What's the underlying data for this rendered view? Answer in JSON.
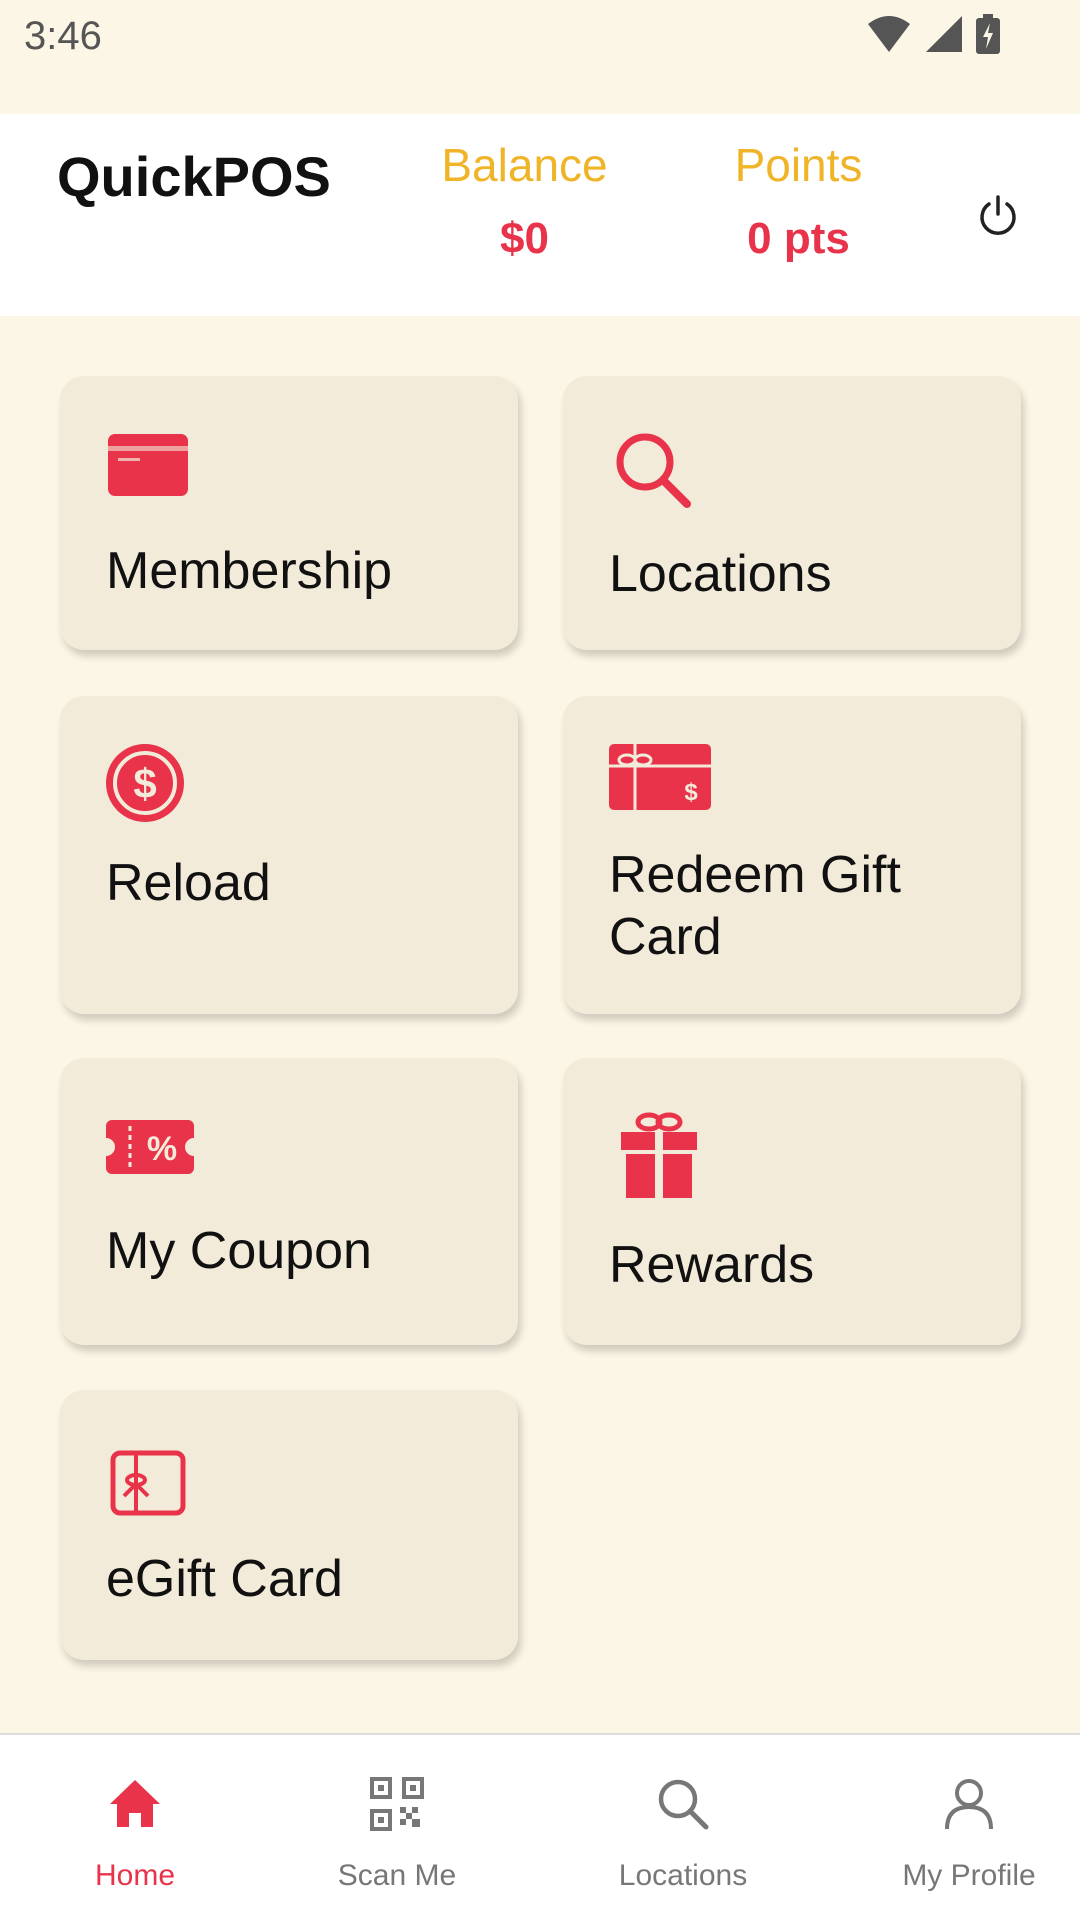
{
  "status_bar": {
    "time": "3:46"
  },
  "header": {
    "title": "QuickPOS",
    "balance_label": "Balance",
    "balance_value": "$0",
    "points_label": "Points",
    "points_value": "0 pts"
  },
  "tiles": [
    {
      "label": "Membership"
    },
    {
      "label": "Locations"
    },
    {
      "label": "Reload"
    },
    {
      "label_line1": "Redeem Gift",
      "label_line2": "Card"
    },
    {
      "label": "My Coupon"
    },
    {
      "label": "Rewards"
    },
    {
      "label": "eGift Card"
    }
  ],
  "nav": [
    {
      "label": "Home"
    },
    {
      "label": "Scan Me"
    },
    {
      "label": "Locations"
    },
    {
      "label": "My Profile"
    }
  ],
  "colors": {
    "accent": "#e8334a",
    "gold": "#f0b429",
    "tile_bg": "#f3ebda",
    "page_bg": "#fcf6e6"
  }
}
